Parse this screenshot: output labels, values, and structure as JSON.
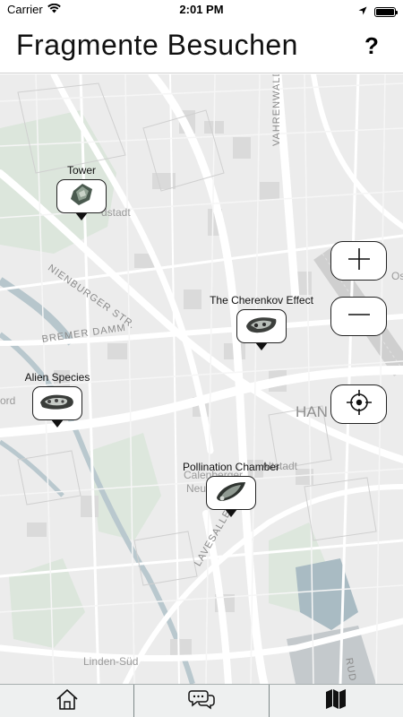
{
  "status_bar": {
    "carrier": "Carrier",
    "time": "2:01 PM",
    "battery_level": 1.0
  },
  "header": {
    "title": "Fragmente Besuchen",
    "help_label": "?"
  },
  "map": {
    "streets": {
      "vahrenwalder": "VAHRENWALD",
      "nienburger": "NIENBURGER STR.",
      "bremer_damm": "BREMER DAMM",
      "lavesallee": "LAVESALLE"
    },
    "districts": {
      "nordstadt": "dstadt",
      "calenberger": "Calenberger",
      "neustadt": "Neustadt",
      "altstadt": "Altstadt",
      "linden_sued": "Linden-Süd",
      "ford": "ord",
      "os": "Os",
      "rud": "RUD"
    },
    "city": "HAN",
    "colors": {
      "background": "#ececec",
      "green": "#d6e4d6",
      "water": "#a8bcc4",
      "road": "#ffffff",
      "building": "#dcdcdc"
    }
  },
  "fragments": [
    {
      "title": "Tower",
      "icon": "tower-fragment-icon"
    },
    {
      "title": "The Cherenkov Effect",
      "icon": "cherenkov-fragment-icon"
    },
    {
      "title": "Alien Species",
      "icon": "alien-species-fragment-icon"
    },
    {
      "title": "Pollination Chamber",
      "icon": "pollination-chamber-fragment-icon"
    }
  ],
  "controls": {
    "zoom_in": "plus-icon",
    "zoom_out": "minus-icon",
    "locate": "crosshair-icon"
  },
  "tabs": [
    {
      "name": "home",
      "icon": "home-icon",
      "active": false
    },
    {
      "name": "chat",
      "icon": "chat-bubbles-icon",
      "active": false
    },
    {
      "name": "map",
      "icon": "map-icon",
      "active": true
    }
  ]
}
